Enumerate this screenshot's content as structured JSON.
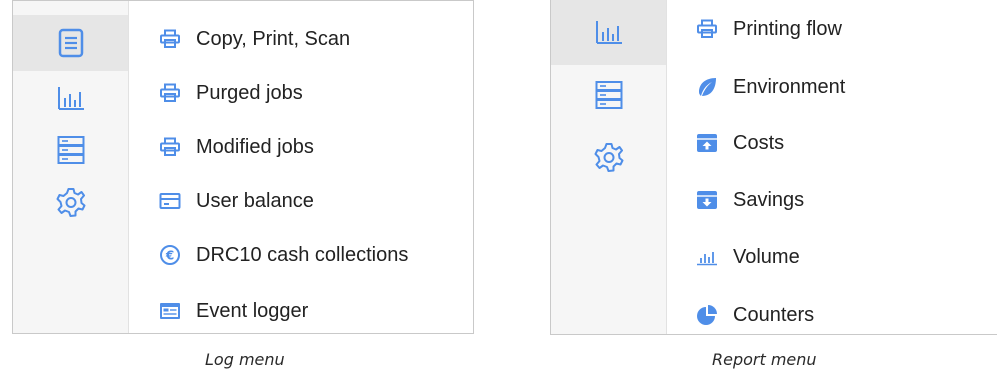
{
  "log_panel": {
    "rail": [
      "log-icon",
      "report-icon",
      "server-icon",
      "settings-icon"
    ],
    "items": [
      {
        "label": "Copy, Print, Scan",
        "icon": "printer-icon"
      },
      {
        "label": "Purged jobs",
        "icon": "printer-icon"
      },
      {
        "label": "Modified jobs",
        "icon": "printer-icon"
      },
      {
        "label": "User balance",
        "icon": "card-icon"
      },
      {
        "label": "DRC10 cash collections",
        "icon": "euro-icon"
      },
      {
        "label": "Event logger",
        "icon": "event-log-icon"
      }
    ],
    "caption": "Log menu"
  },
  "report_panel": {
    "rail": [
      "report-icon",
      "server-icon",
      "settings-icon"
    ],
    "items": [
      {
        "label": "Printing flow",
        "icon": "printer-icon"
      },
      {
        "label": "Environment",
        "icon": "leaf-icon"
      },
      {
        "label": "Costs",
        "icon": "costs-box-icon"
      },
      {
        "label": "Savings",
        "icon": "savings-box-icon"
      },
      {
        "label": "Volume",
        "icon": "volume-chart-icon"
      },
      {
        "label": "Counters",
        "icon": "pie-chart-icon"
      }
    ],
    "caption": "Report menu"
  },
  "colors": {
    "accent": "#4f8ee8",
    "rail_bg": "#f6f6f6",
    "rail_active": "#e6e6e6",
    "border": "#c9c9c9"
  }
}
